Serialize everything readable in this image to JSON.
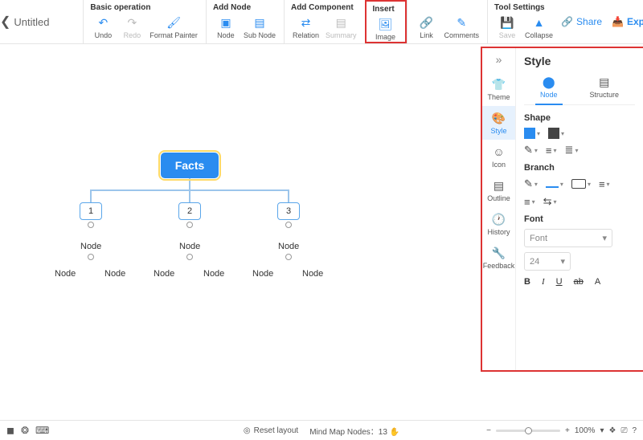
{
  "doc": {
    "title": "Untitled"
  },
  "toolbar": {
    "groups": {
      "basic": {
        "title": "Basic operation",
        "undo": "Undo",
        "redo": "Redo",
        "format": "Format Painter"
      },
      "addnode": {
        "title": "Add Node",
        "node": "Node",
        "subnode": "Sub Node"
      },
      "addcomp": {
        "title": "Add Component",
        "relation": "Relation",
        "summary": "Summary"
      },
      "insert": {
        "title": "Insert",
        "image": "Image",
        "link": "Link",
        "comments": "Comments"
      },
      "tools": {
        "title": "Tool Settings",
        "save": "Save",
        "collapse": "Collapse"
      }
    },
    "share": "Share",
    "export": "Export"
  },
  "mindmap": {
    "root": "Facts",
    "children": [
      "1",
      "2",
      "3"
    ],
    "nodeLabel": "Node"
  },
  "panel": {
    "title": "Style",
    "side": {
      "theme": "Theme",
      "style": "Style",
      "icon": "Icon",
      "outline": "Outline",
      "history": "History",
      "feedback": "Feedback"
    },
    "tabs": {
      "node": "Node",
      "structure": "Structure"
    },
    "sections": {
      "shape": "Shape",
      "branch": "Branch",
      "font": "Font"
    },
    "font": {
      "placeholder": "Font",
      "size": "24",
      "bold": "B",
      "italic": "I",
      "underline": "U",
      "strike": "ab",
      "color": "A"
    }
  },
  "bottom": {
    "reset": "Reset layout",
    "nodesLabel": "Mind Map Nodes：",
    "nodesCount": "13",
    "zoom": "100%"
  }
}
